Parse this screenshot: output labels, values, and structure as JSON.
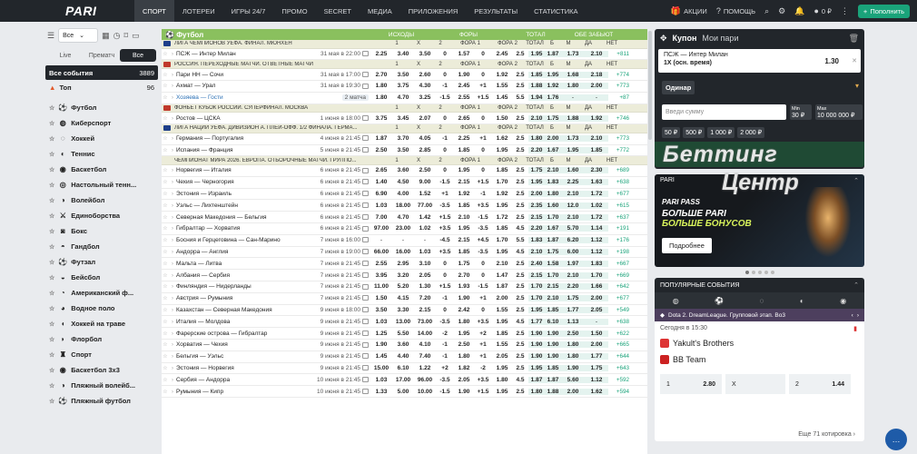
{
  "header": {
    "logo": "PARI",
    "nav": [
      "СПОРТ",
      "ЛОТЕРЕИ",
      "ИГРЫ 24/7",
      "ПРОМО",
      "SECRET",
      "МЕДИА",
      "ПРИЛОЖЕНИЯ",
      "РЕЗУЛЬТАТЫ",
      "СТАТИСТИКА"
    ],
    "actions": "АКЦИИ",
    "help": "ПОМОЩЬ",
    "balance": "0 ₽",
    "deposit": "Пополнить"
  },
  "sidebar": {
    "filter": "Все",
    "tabs": [
      "Live",
      "Прематч",
      "Все"
    ],
    "all_events": {
      "label": "Все события",
      "count": "3889"
    },
    "top": {
      "label": "Топ",
      "count": "96"
    },
    "sports": [
      "Футбол",
      "Киберспорт",
      "Хоккей",
      "Теннис",
      "Баскетбол",
      "Настольный тенн...",
      "Волейбол",
      "Единоборства",
      "Бокс",
      "Гандбол",
      "Футзал",
      "Бейсбол",
      "Американский ф...",
      "Водное поло",
      "Хоккей на траве",
      "Флорбол",
      "Спорт",
      "Баскетбол 3x3",
      "Пляжный волейб...",
      "Пляжный футбол"
    ]
  },
  "table": {
    "title": "Футбол",
    "columns": [
      "1",
      "X",
      "2",
      "ФОРА 1",
      "ФОРА 2",
      "ТОТАЛ",
      "Б",
      "М",
      "ДА",
      "НЕТ"
    ],
    "group_headers": {
      "outcomes": "ИСХОДЫ",
      "fora": "ФОРЫ",
      "total": "ТОТАЛ",
      "both": "ОБЕ ЗАБЬЮТ"
    },
    "rows": [
      {
        "kind": "league",
        "text": "ЛИГА ЧЕМПИОНОВ УЕФА. ФИНАЛ. МЮНХЕН",
        "color": "#1f3f8a"
      },
      {
        "teams": "ПСЖ — Интер Милан",
        "time": "31 мая в 22:00",
        "o": [
          "2.25",
          "3.40",
          "3.50",
          "0",
          "1.57",
          "0",
          "2.45",
          "2.5",
          "1.95",
          "1.87",
          "1.73",
          "2.10"
        ],
        "more": "+811"
      },
      {
        "kind": "league",
        "text": "РОССИЯ. ПЕРЕХОДНЫЕ МАТЧИ. ОТВЕТНЫЕ МАТЧИ",
        "color": "#c0392b"
      },
      {
        "teams": "Пари НН — Сочи",
        "time": "31 мая в 17:00",
        "o": [
          "2.70",
          "3.50",
          "2.60",
          "0",
          "1.90",
          "0",
          "1.92",
          "2.5",
          "1.85",
          "1.95",
          "1.68",
          "2.18"
        ],
        "more": "+774"
      },
      {
        "teams": "Ахмат — Урал",
        "time": "31 мая в 19:30",
        "o": [
          "1.80",
          "3.75",
          "4.30",
          "-1",
          "2.45",
          "+1",
          "1.55",
          "2.5",
          "1.88",
          "1.92",
          "1.80",
          "2.00"
        ],
        "more": "+773"
      },
      {
        "teams": "Хозяева — Гости",
        "badge": "2 матча",
        "link": true,
        "o": [
          "1.80",
          "4.70",
          "3.25",
          "-1.5",
          "2.55",
          "+1.5",
          "1.45",
          "5.5",
          "1.94",
          "1.76",
          "-",
          "-"
        ],
        "more": "+87"
      },
      {
        "kind": "league",
        "text": "ФОНБЕТ КУБОК РОССИИ. СУПЕРФИНАЛ. МОСКВА",
        "color": "#c0392b"
      },
      {
        "teams": "Ростов — ЦСКА",
        "time": "1 июня в 18:00",
        "o": [
          "3.75",
          "3.45",
          "2.07",
          "0",
          "2.65",
          "0",
          "1.50",
          "2.5",
          "2.10",
          "1.75",
          "1.88",
          "1.92"
        ],
        "more": "+746"
      },
      {
        "kind": "league",
        "text": "ЛИГА НАЦИЙ УЕФА. ДИВИЗИОН А. ПЛЕЙ-ОФФ. 1/2 ФИНАЛА. ГЕРМА...",
        "color": "#1f3f8a"
      },
      {
        "teams": "Германия — Португалия",
        "time": "4 июня в 21:45",
        "o": [
          "1.87",
          "3.70",
          "4.05",
          "-1",
          "2.25",
          "+1",
          "1.62",
          "2.5",
          "1.80",
          "2.00",
          "1.73",
          "2.10"
        ],
        "more": "+773"
      },
      {
        "teams": "Испания — Франция",
        "time": "5 июня в 21:45",
        "o": [
          "2.50",
          "3.50",
          "2.85",
          "0",
          "1.85",
          "0",
          "1.95",
          "2.5",
          "2.20",
          "1.67",
          "1.95",
          "1.85"
        ],
        "more": "+772"
      },
      {
        "kind": "league",
        "plain": true,
        "text": "ЧЕМПИОНАТ МИРА 2026. ЕВРОПА. ОТБОРОЧНЫЕ МАТЧИ. ГРУППО..."
      },
      {
        "teams": "Норвегия — Италия",
        "time": "6 июня в 21:45",
        "o": [
          "2.65",
          "3.60",
          "2.50",
          "0",
          "1.95",
          "0",
          "1.85",
          "2.5",
          "1.75",
          "2.10",
          "1.60",
          "2.30"
        ],
        "more": "+689"
      },
      {
        "teams": "Чехия — Черногория",
        "time": "6 июня в 21:45",
        "o": [
          "1.40",
          "4.50",
          "9.00",
          "-1.5",
          "2.15",
          "+1.5",
          "1.70",
          "2.5",
          "1.95",
          "1.83",
          "2.25",
          "1.63"
        ],
        "more": "+638"
      },
      {
        "teams": "Эстония — Израиль",
        "time": "6 июня в 21:45",
        "o": [
          "6.90",
          "4.00",
          "1.52",
          "+1",
          "1.92",
          "-1",
          "1.92",
          "2.5",
          "2.00",
          "1.80",
          "2.10",
          "1.72"
        ],
        "more": "+677"
      },
      {
        "teams": "Уэльс — Лихтенштейн",
        "time": "6 июня в 21:45",
        "o": [
          "1.03",
          "18.00",
          "77.00",
          "-3.5",
          "1.85",
          "+3.5",
          "1.95",
          "2.5",
          "2.35",
          "1.60",
          "12.0",
          "1.02"
        ],
        "more": "+615"
      },
      {
        "teams": "Северная Македония — Бельгия",
        "time": "6 июня в 21:45",
        "o": [
          "7.00",
          "4.70",
          "1.42",
          "+1.5",
          "2.10",
          "-1.5",
          "1.72",
          "2.5",
          "2.15",
          "1.70",
          "2.10",
          "1.72"
        ],
        "more": "+637"
      },
      {
        "teams": "Гибралтар — Хорватия",
        "time": "6 июня в 21:45",
        "o": [
          "97.00",
          "23.00",
          "1.02",
          "+3.5",
          "1.95",
          "-3.5",
          "1.85",
          "4.5",
          "2.20",
          "1.67",
          "5.70",
          "1.14"
        ],
        "more": "+191"
      },
      {
        "teams": "Босния и Герцеговина — Сан-Марино",
        "time": "7 июня в 16:00",
        "o": [
          "-",
          "-",
          "-",
          "-4.5",
          "2.15",
          "+4.5",
          "1.70",
          "5.5",
          "1.83",
          "1.87",
          "6.20",
          "1.12"
        ],
        "more": "+176"
      },
      {
        "teams": "Андорра — Англия",
        "time": "7 июня в 19:00",
        "o": [
          "66.00",
          "16.00",
          "1.03",
          "+3.5",
          "1.85",
          "-3.5",
          "1.95",
          "4.5",
          "2.10",
          "1.75",
          "6.00",
          "1.12"
        ],
        "more": "+198"
      },
      {
        "teams": "Мальта — Литва",
        "time": "7 июня в 21:45",
        "o": [
          "2.55",
          "2.95",
          "3.10",
          "0",
          "1.75",
          "0",
          "2.10",
          "2.5",
          "2.40",
          "1.58",
          "1.97",
          "1.83"
        ],
        "more": "+667"
      },
      {
        "teams": "Албания — Сербия",
        "time": "7 июня в 21:45",
        "o": [
          "3.95",
          "3.20",
          "2.05",
          "0",
          "2.70",
          "0",
          "1.47",
          "2.5",
          "2.15",
          "1.70",
          "2.10",
          "1.70"
        ],
        "more": "+669"
      },
      {
        "teams": "Финляндия — Нидерланды",
        "time": "7 июня в 21:45",
        "o": [
          "11.00",
          "5.20",
          "1.30",
          "+1.5",
          "1.93",
          "-1.5",
          "1.87",
          "2.5",
          "1.70",
          "2.15",
          "2.20",
          "1.66"
        ],
        "more": "+642"
      },
      {
        "teams": "Австрия — Румыния",
        "time": "7 июня в 21:45",
        "o": [
          "1.50",
          "4.15",
          "7.20",
          "-1",
          "1.90",
          "+1",
          "2.00",
          "2.5",
          "1.70",
          "2.10",
          "1.75",
          "2.00"
        ],
        "more": "+677"
      },
      {
        "teams": "Казахстан — Северная Македония",
        "time": "9 июня в 18:00",
        "o": [
          "3.50",
          "3.30",
          "2.15",
          "0",
          "2.42",
          "0",
          "1.55",
          "2.5",
          "1.95",
          "1.85",
          "1.77",
          "2.05"
        ],
        "more": "+549"
      },
      {
        "teams": "Италия — Молдова",
        "time": "9 июня в 21:45",
        "o": [
          "1.03",
          "13.00",
          "73.00",
          "-3.5",
          "1.80",
          "+3.5",
          "1.95",
          "4.5",
          "1.77",
          "6.10",
          "1.13",
          "-"
        ],
        "more": "+638"
      },
      {
        "teams": "Фарерские острова — Гибралтар",
        "time": "9 июня в 21:45",
        "o": [
          "1.25",
          "5.50",
          "14.00",
          "-2",
          "1.95",
          "+2",
          "1.85",
          "2.5",
          "1.90",
          "1.90",
          "2.50",
          "1.50"
        ],
        "more": "+622"
      },
      {
        "teams": "Хорватия — Чехия",
        "time": "9 июня в 21:45",
        "o": [
          "1.90",
          "3.60",
          "4.10",
          "-1",
          "2.50",
          "+1",
          "1.55",
          "2.5",
          "1.90",
          "1.90",
          "1.80",
          "2.00"
        ],
        "more": "+665"
      },
      {
        "teams": "Бельгия — Уэльс",
        "time": "9 июня в 21:45",
        "o": [
          "1.45",
          "4.40",
          "7.40",
          "-1",
          "1.80",
          "+1",
          "2.05",
          "2.5",
          "1.90",
          "1.90",
          "1.80",
          "1.77"
        ],
        "more": "+644"
      },
      {
        "teams": "Эстония — Норвегия",
        "time": "9 июня в 21:45",
        "o": [
          "15.00",
          "6.10",
          "1.22",
          "+2",
          "1.82",
          "-2",
          "1.95",
          "2.5",
          "1.95",
          "1.85",
          "1.90",
          "1.75"
        ],
        "more": "+643"
      },
      {
        "teams": "Сербия — Андорра",
        "time": "10 июня в 21:45",
        "o": [
          "1.03",
          "17.00",
          "96.00",
          "-3.5",
          "2.05",
          "+3.5",
          "1.80",
          "4.5",
          "1.87",
          "1.87",
          "5.60",
          "1.12"
        ],
        "more": "+592"
      },
      {
        "teams": "Румыния — Кипр",
        "time": "10 июня в 21:45",
        "o": [
          "1.33",
          "5.00",
          "10.00",
          "-1.5",
          "1.90",
          "+1.5",
          "1.95",
          "2.5",
          "1.80",
          "1.88",
          "2.00",
          "1.62"
        ],
        "more": "+594"
      }
    ]
  },
  "coupon": {
    "title": "Купон",
    "tab2": "Мои пари",
    "bet_match": "ПСЖ — Интер Милан",
    "bet_outcome": "1X (осн. время)",
    "bet_coef": "1.30",
    "mode": "Одинар",
    "sum_placeholder": "Введи сумму",
    "min_label": "Min",
    "min_value": "30 ₽",
    "max_label": "Max",
    "max_value": "10 000 000 ₽",
    "chips": [
      "50 ₽",
      "500 ₽",
      "1 000 ₽",
      "2 000 ₽"
    ]
  },
  "watermark": {
    "line1": "Беттинг",
    "line2": "Центр"
  },
  "banner": {
    "label": "PARI",
    "pass": "PARI PASS",
    "line1": "БОЛЬШЕ PARI",
    "line2": "БОЛЬШЕ БОНУСОВ",
    "button": "Подробнее"
  },
  "popular": {
    "title": "ПОПУЛЯРНЫЕ СОБЫТИЯ",
    "league": "Dota 2. DreamLeague. Групповой этап. Bo3",
    "when": "Сегодня в 15:30",
    "team1": "Yakult's Brothers",
    "team2": "BB Team",
    "odds": [
      {
        "k": "1",
        "v": "2.80"
      },
      {
        "k": "X",
        "v": ""
      },
      {
        "k": "2",
        "v": "1.44"
      }
    ],
    "more": "Еще 71 котировка"
  },
  "colors": {
    "green": "#8ac05e",
    "dark": "#22262b",
    "accent": "#1aa37a"
  }
}
